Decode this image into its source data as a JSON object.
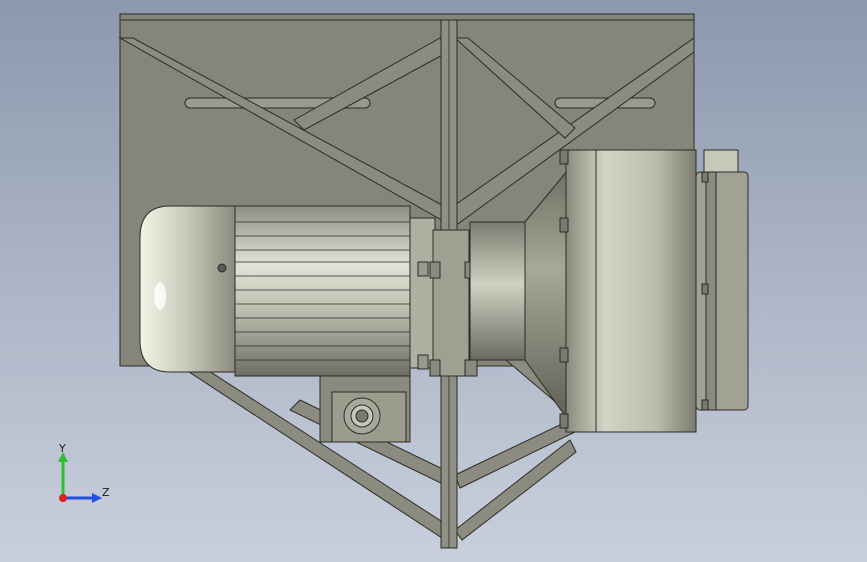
{
  "viewport": {
    "background_top": "#8c98ad",
    "background_bottom": "#c9cfdc"
  },
  "model": {
    "frame_color": "#86867a",
    "frame_edge": "#2b2b27",
    "motor_color": "#c4c4b6",
    "fan_housing_color": "#b8b8a6"
  },
  "triad": {
    "y_label": "Y",
    "z_label": "Z",
    "y_color": "#2ec02e",
    "z_color": "#2050e0",
    "x_color": "#e02020"
  }
}
